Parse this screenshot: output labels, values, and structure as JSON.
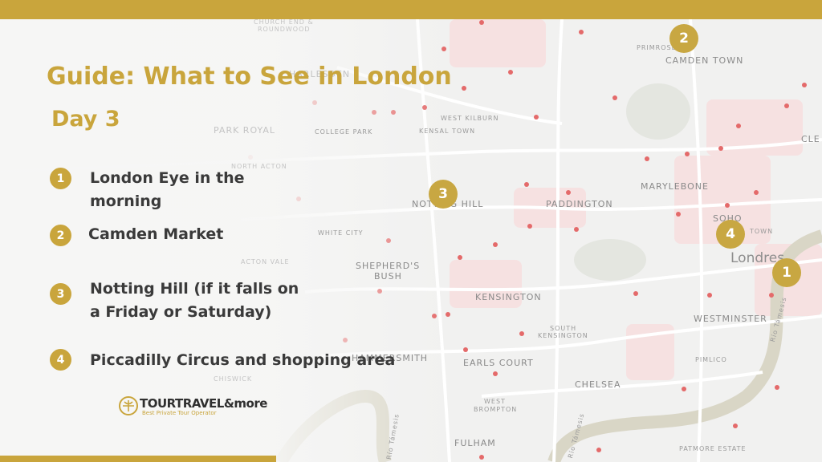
{
  "colors": {
    "accent": "#c9a53c",
    "map_bg": "#f3f3f2",
    "road": "#ffffff",
    "river": "#d8d6c9",
    "station": "#e05a5a"
  },
  "title": "Guide: What to See in London",
  "day": "Day 3",
  "itinerary": [
    {
      "num": "1",
      "text": "London Eye in the morning"
    },
    {
      "num": "2",
      "text": "Camden Market"
    },
    {
      "num": "3",
      "text": "Notting Hill (if it falls on a Friday or Saturday)"
    },
    {
      "num": "4",
      "text": "Piccadilly Circus and shopping area"
    }
  ],
  "map": {
    "labels": {
      "church_end": "CHURCH END &",
      "roundwood": "ROUNDWOOD",
      "harlesden": "HARLESDEN",
      "park_royal": "PARK ROYAL",
      "north_acton": "NORTH ACTON",
      "college_park": "COLLEGE PARK",
      "west_kilburn": "WEST KILBURN",
      "kensal_town": "KENSAL TOWN",
      "primrose": "PRIMROSE",
      "camden_town": "CAMDEN TOWN",
      "marylebone": "MARYLEBONE",
      "notting_hill": "NOTTING HILL",
      "paddington": "PADDINGTON",
      "white_city": "WHITE CITY",
      "acton_vale": "ACTON VALE",
      "shepherds": "SHEPHERD'S",
      "bush": "BUSH",
      "soho": "SOHO",
      "town": "TOWN",
      "londres": "Londres",
      "kensington": "KENSINGTON",
      "westminster": "WESTMINSTER",
      "south": "SOUTH",
      "south_kensington": "KENSINGTON",
      "hammersmith": "HAMMERSMITH",
      "earls_court": "EARLS COURT",
      "pimlico": "PIMLICO",
      "chelsea": "CHELSEA",
      "west": "WEST",
      "brompton": "BROMPTON",
      "fulham": "FULHAM",
      "patmore_estate": "PATMORE ESTATE",
      "cle": "CLE",
      "chiswick": "CHISWICK",
      "rio_tamesis_1": "Río Támesis",
      "rio_tamesis_2": "Río Támesis",
      "rio_tamesis_3": "Río Támesis"
    },
    "markers": [
      "1",
      "2",
      "3",
      "4"
    ]
  },
  "logo": {
    "main": "TOURTRAVEL&more",
    "tagline": "Best Private Tour Operator"
  }
}
